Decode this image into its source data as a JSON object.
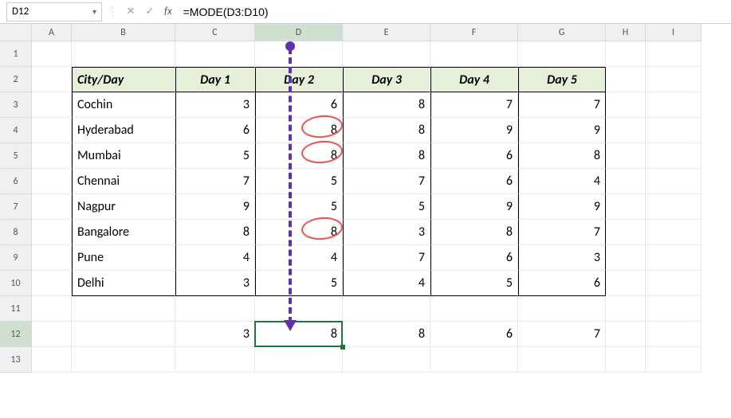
{
  "namebox": "D12",
  "formula": "=MODE(D3:D10)",
  "columns": [
    "A",
    "B",
    "C",
    "D",
    "E",
    "F",
    "G",
    "H",
    "I"
  ],
  "rows": [
    "1",
    "2",
    "3",
    "4",
    "5",
    "6",
    "7",
    "8",
    "9",
    "10",
    "11",
    "12",
    "13"
  ],
  "headers": {
    "b": "City/Day",
    "c": "Day 1",
    "d": "Day 2",
    "e": "Day 3",
    "f": "Day 4",
    "g": "Day 5"
  },
  "cities": [
    "Cochin",
    "Hyderabad",
    "Mumbai",
    "Chennai",
    "Nagpur",
    "Bangalore",
    "Pune",
    "Delhi"
  ],
  "data": {
    "c": [
      "3",
      "6",
      "5",
      "7",
      "9",
      "8",
      "4",
      "3"
    ],
    "d": [
      "6",
      "8",
      "8",
      "5",
      "5",
      "8",
      "4",
      "5"
    ],
    "e": [
      "8",
      "8",
      "8",
      "7",
      "5",
      "3",
      "7",
      "4"
    ],
    "f": [
      "7",
      "9",
      "6",
      "6",
      "9",
      "8",
      "6",
      "5"
    ],
    "g": [
      "7",
      "9",
      "8",
      "4",
      "9",
      "7",
      "3",
      "6"
    ]
  },
  "results": {
    "c": "3",
    "d": "8",
    "e": "8",
    "f": "6",
    "g": "7"
  },
  "chart_data": {
    "type": "table",
    "title": "MODE of daily values per column",
    "columns": [
      "City/Day",
      "Day 1",
      "Day 2",
      "Day 3",
      "Day 4",
      "Day 5"
    ],
    "rows": [
      [
        "Cochin",
        3,
        6,
        8,
        7,
        7
      ],
      [
        "Hyderabad",
        6,
        8,
        8,
        9,
        9
      ],
      [
        "Mumbai",
        5,
        8,
        8,
        6,
        8
      ],
      [
        "Chennai",
        7,
        5,
        7,
        6,
        4
      ],
      [
        "Nagpur",
        9,
        5,
        5,
        9,
        9
      ],
      [
        "Bangalore",
        8,
        8,
        3,
        8,
        7
      ],
      [
        "Pune",
        4,
        4,
        7,
        6,
        3
      ],
      [
        "Delhi",
        3,
        5,
        4,
        5,
        6
      ]
    ],
    "mode_row": [
      3,
      8,
      8,
      6,
      7
    ]
  }
}
